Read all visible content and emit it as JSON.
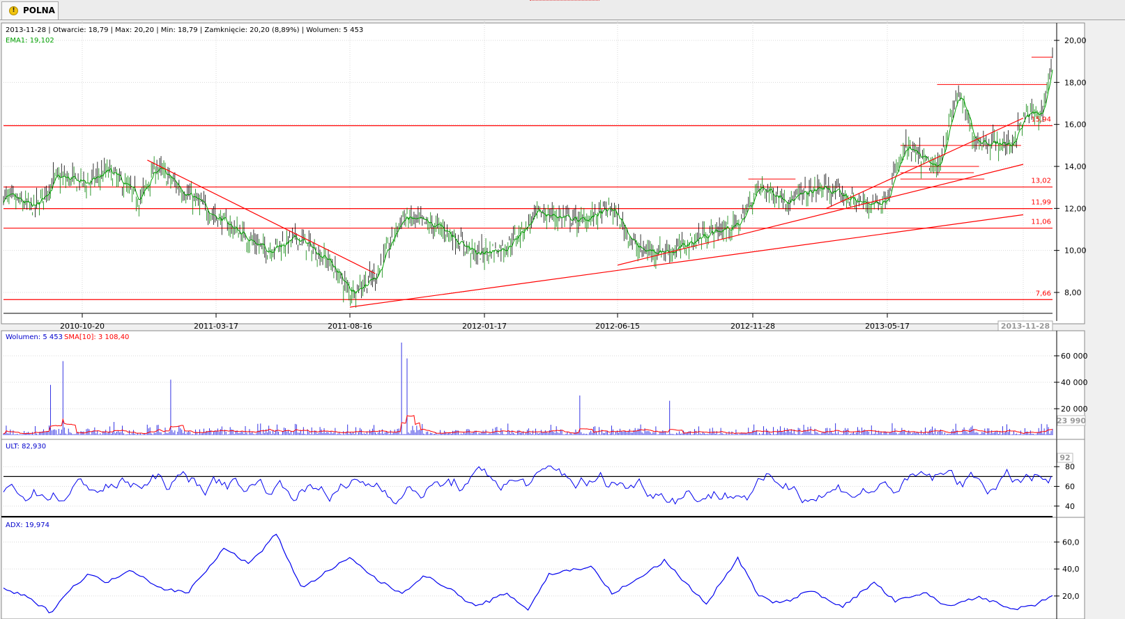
{
  "tab": {
    "label": "POLNA",
    "icon": "warning-icon"
  },
  "price_header": {
    "info": "2013-11-28 | Otwarcie: 18,79 | Max: 20,20 | Min: 18,79 | Zamknięcie: 20,20 (8,89%) | Wolumen: 5 453",
    "ema": "EMA1: 19,102"
  },
  "volume_header": {
    "vol": "Wolumen: 5 453",
    "sma": "SMA[10]: 3 108,40"
  },
  "ult_header": "ULT: 82,930",
  "adx_header": "ADX: 19,974",
  "colors": {
    "up": "#008000",
    "down": "#000000",
    "ema": "#00a000",
    "lines": "#ff0000",
    "volume": "#0000dd",
    "sma": "#ff0000",
    "ult": "#0000ee",
    "adx": "#0000ee"
  },
  "chart_data": [
    {
      "type": "candlestick",
      "x_dates": [
        "2010-10-20",
        "2011-03-17",
        "2011-08-16",
        "2012-01-17",
        "2012-06-15",
        "2012-11-28",
        "2013-05-17"
      ],
      "last_date": "2013-11-28",
      "y_ticks": [
        "8,00",
        "10,00",
        "12,00",
        "14,00",
        "16,00",
        "18,00",
        "20,00"
      ],
      "ylim": [
        7.1,
        20.9
      ],
      "close_path": [
        [
          0,
          12.6
        ],
        [
          0.03,
          12.0
        ],
        [
          0.05,
          13.5
        ],
        [
          0.08,
          13.2
        ],
        [
          0.1,
          13.8
        ],
        [
          0.13,
          12.4
        ],
        [
          0.145,
          14.0
        ],
        [
          0.17,
          12.9
        ],
        [
          0.2,
          11.7
        ],
        [
          0.25,
          10.0
        ],
        [
          0.28,
          10.6
        ],
        [
          0.31,
          9.5
        ],
        [
          0.33,
          8.0
        ],
        [
          0.355,
          8.8
        ],
        [
          0.38,
          11.6
        ],
        [
          0.42,
          11.0
        ],
        [
          0.45,
          9.8
        ],
        [
          0.48,
          10.2
        ],
        [
          0.51,
          11.8
        ],
        [
          0.55,
          11.4
        ],
        [
          0.58,
          12.0
        ],
        [
          0.605,
          10.0
        ],
        [
          0.64,
          10.0
        ],
        [
          0.67,
          10.8
        ],
        [
          0.7,
          11.2
        ],
        [
          0.72,
          13.0
        ],
        [
          0.75,
          12.4
        ],
        [
          0.78,
          13.0
        ],
        [
          0.82,
          12.2
        ],
        [
          0.84,
          12.4
        ],
        [
          0.86,
          14.9
        ],
        [
          0.89,
          13.8
        ],
        [
          0.91,
          17.6
        ],
        [
          0.925,
          15.3
        ],
        [
          0.96,
          15.0
        ],
        [
          0.975,
          16.5
        ],
        [
          0.99,
          16.5
        ],
        [
          1.0,
          19.2
        ]
      ],
      "horizontal_lines": [
        7.66,
        11.06,
        11.99,
        13.02,
        15.94
      ],
      "level_labels": [
        "7,66",
        "11,06",
        "11,99",
        "13,02",
        "15,94"
      ],
      "extra_levels": [
        13.4,
        13.7,
        14.0,
        15.0,
        17.9,
        19.2
      ],
      "trendlines": [
        {
          "from": [
            "2010-12-31",
            14.3
          ],
          "to": [
            "2011-09-14",
            8.9
          ]
        },
        {
          "from": [
            "2011-08-16",
            7.3
          ],
          "to": [
            "2013-11-28",
            11.7
          ]
        },
        {
          "from": [
            "2012-06-15",
            9.3
          ],
          "to": [
            "2013-11-28",
            14.1
          ]
        },
        {
          "from": [
            "2013-03-01",
            12.0
          ],
          "to": [
            "2013-11-28",
            16.3
          ]
        }
      ]
    },
    {
      "type": "bar",
      "name": "Wolumen",
      "y_ticks": [
        "20 000",
        "40 000",
        "60 000"
      ],
      "ylim": [
        0,
        70000
      ],
      "last_value_tag": "23 990",
      "spikes": [
        [
          0.045,
          38000
        ],
        [
          0.057,
          56000
        ],
        [
          0.105,
          10000
        ],
        [
          0.16,
          42000
        ],
        [
          0.38,
          70000
        ],
        [
          0.385,
          58000
        ],
        [
          0.55,
          30000
        ],
        [
          0.635,
          26000
        ]
      ]
    },
    {
      "type": "line",
      "name": "ULT",
      "y_ticks": [
        "40",
        "60",
        "80"
      ],
      "ylim": [
        30,
        95
      ],
      "reference": 70,
      "last_value_tag": "92"
    },
    {
      "type": "line",
      "name": "ADX",
      "y_ticks": [
        "20,0",
        "40,0",
        "60,0"
      ],
      "ylim": [
        5,
        70
      ],
      "path": [
        [
          0,
          25
        ],
        [
          0.02,
          20
        ],
        [
          0.045,
          8
        ],
        [
          0.06,
          22
        ],
        [
          0.08,
          36
        ],
        [
          0.1,
          30
        ],
        [
          0.12,
          40
        ],
        [
          0.15,
          26
        ],
        [
          0.175,
          22
        ],
        [
          0.21,
          55
        ],
        [
          0.235,
          44
        ],
        [
          0.26,
          66
        ],
        [
          0.285,
          25
        ],
        [
          0.3,
          34
        ],
        [
          0.33,
          48
        ],
        [
          0.36,
          30
        ],
        [
          0.38,
          22
        ],
        [
          0.4,
          35
        ],
        [
          0.42,
          28
        ],
        [
          0.45,
          12
        ],
        [
          0.48,
          22
        ],
        [
          0.5,
          10
        ],
        [
          0.52,
          36
        ],
        [
          0.56,
          42
        ],
        [
          0.58,
          22
        ],
        [
          0.6,
          30
        ],
        [
          0.63,
          46
        ],
        [
          0.65,
          30
        ],
        [
          0.67,
          14
        ],
        [
          0.7,
          48
        ],
        [
          0.72,
          20
        ],
        [
          0.74,
          14
        ],
        [
          0.77,
          24
        ],
        [
          0.8,
          12
        ],
        [
          0.83,
          30
        ],
        [
          0.85,
          16
        ],
        [
          0.88,
          22
        ],
        [
          0.9,
          12
        ],
        [
          0.93,
          20
        ],
        [
          0.96,
          10
        ],
        [
          0.98,
          12
        ],
        [
          1.0,
          20
        ]
      ]
    }
  ]
}
